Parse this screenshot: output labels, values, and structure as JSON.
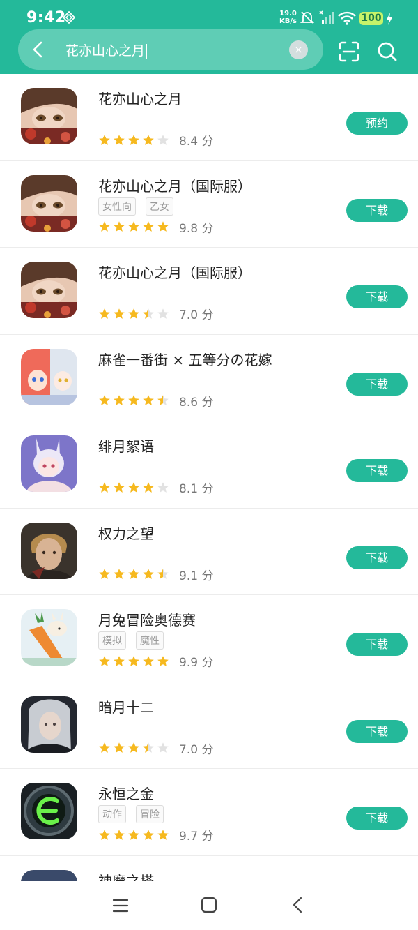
{
  "status": {
    "time": "9:42",
    "net_speed_value": "19.0",
    "net_speed_unit": "KB/s",
    "battery": "100"
  },
  "search": {
    "query": "花亦山心之月",
    "clear_glyph": "×"
  },
  "colors": {
    "accent": "#24b99a",
    "star": "#f6b91f",
    "star_empty": "#e2e2e2"
  },
  "apps": [
    {
      "title": "花亦山心之月",
      "tags": [],
      "rating": 4,
      "score": "8.4 分",
      "action": "预约",
      "icon": "portrait-woman"
    },
    {
      "title": "花亦山心之月（国际服）",
      "tags": [
        "女性向",
        "乙女"
      ],
      "rating": 5,
      "score": "9.8 分",
      "action": "下载",
      "icon": "portrait-woman"
    },
    {
      "title": "花亦山心之月（国际服）",
      "tags": [],
      "rating": 3.5,
      "score": "7.0 分",
      "action": "下载",
      "icon": "portrait-woman"
    },
    {
      "title": "麻雀一番街 × 五等分の花嫁",
      "tags": [],
      "rating": 4.5,
      "score": "8.6 分",
      "action": "下载",
      "icon": "anime-girls"
    },
    {
      "title": "绯月絮语",
      "tags": [],
      "rating": 4,
      "score": "8.1 分",
      "action": "下载",
      "icon": "anime-bunny-girl"
    },
    {
      "title": "权力之望",
      "tags": [],
      "rating": 4.5,
      "score": "9.1 分",
      "action": "下载",
      "icon": "warrior-portrait"
    },
    {
      "title": "月兔冒险奥德赛",
      "tags": [
        "模拟",
        "魔性"
      ],
      "rating": 5,
      "score": "9.9 分",
      "action": "下载",
      "icon": "rabbit-carrot"
    },
    {
      "title": "暗月十二",
      "tags": [],
      "rating": 3.5,
      "score": "7.0 分",
      "action": "下载",
      "icon": "silver-hair-woman"
    },
    {
      "title": "永恒之金",
      "tags": [
        "动作",
        "冒险"
      ],
      "rating": 5,
      "score": "9.7 分",
      "action": "下载",
      "icon": "green-e-emblem"
    },
    {
      "title": "神魔之塔",
      "tags": [],
      "rating": 0,
      "score": "",
      "action": "",
      "icon": "tower-characters"
    }
  ]
}
